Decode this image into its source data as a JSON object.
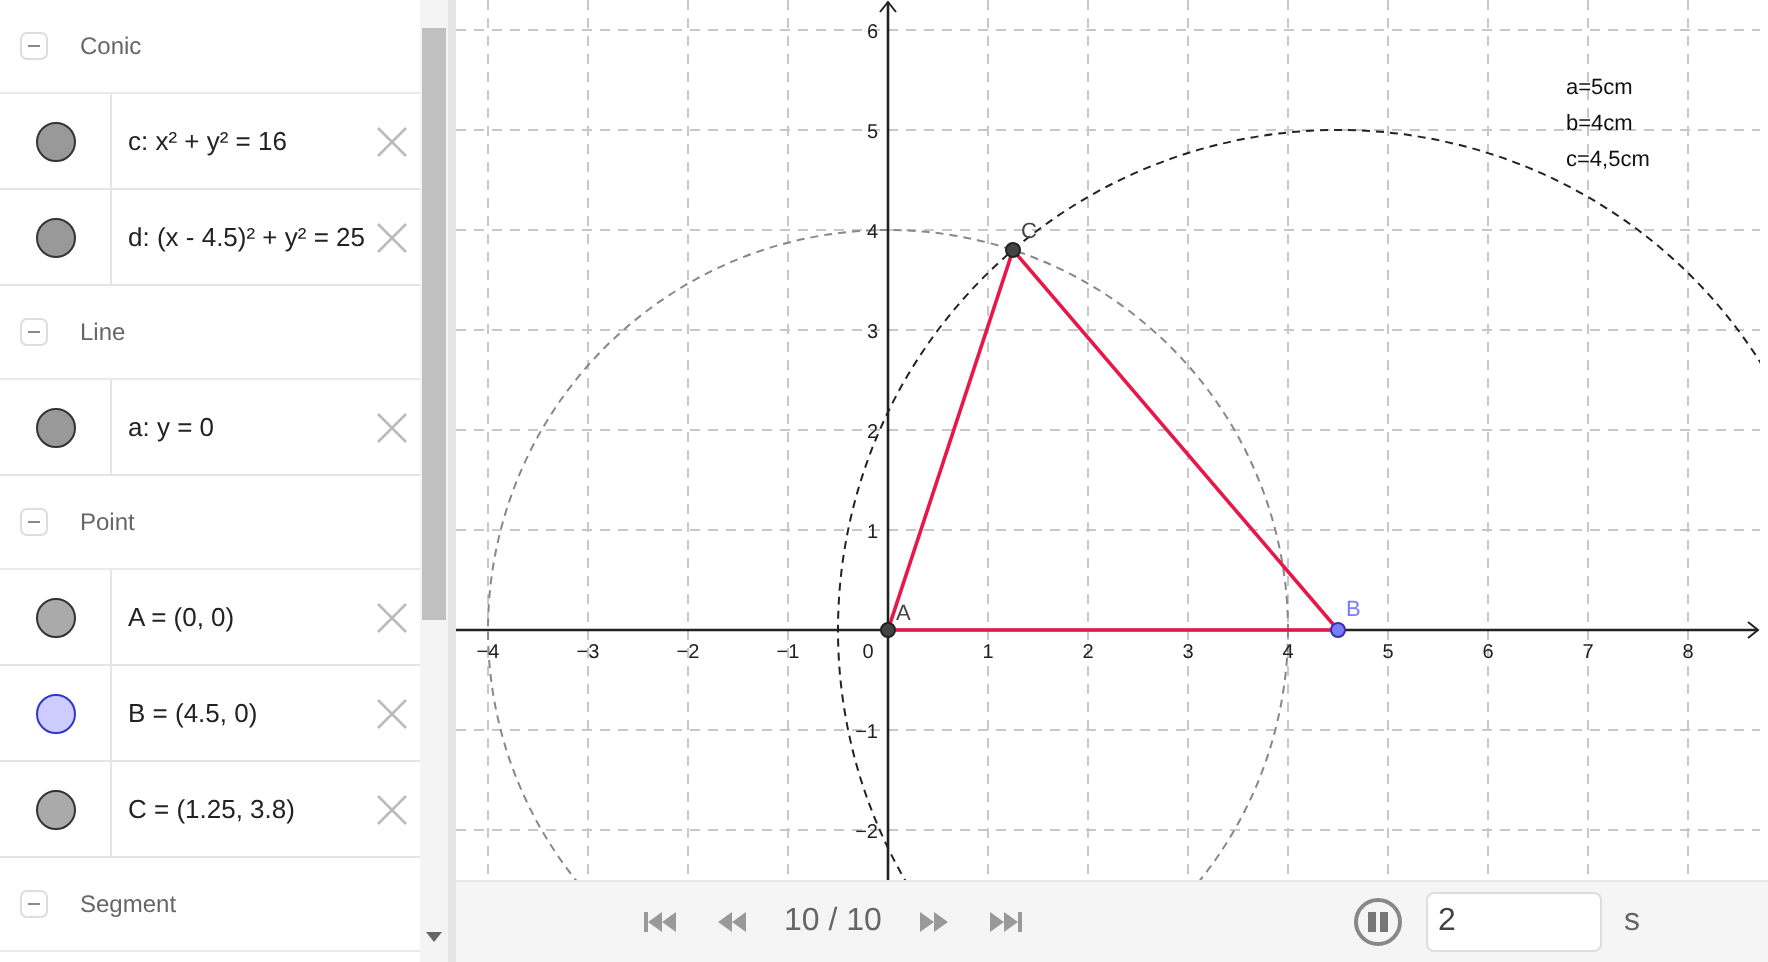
{
  "algebra_view": {
    "groups": [
      {
        "title": "Conic",
        "expanded": true,
        "items": [
          {
            "definition": "c: x² + y² = 16",
            "color": "#999999"
          },
          {
            "definition": "d: (x - 4.5)² + y² = 25",
            "color": "#999999"
          }
        ]
      },
      {
        "title": "Line",
        "expanded": true,
        "items": [
          {
            "definition": "a: y = 0",
            "color": "#999999"
          }
        ]
      },
      {
        "title": "Point",
        "expanded": true,
        "items": [
          {
            "definition": "A = (0, 0)",
            "color": "#aaaaaa"
          },
          {
            "definition": "B = (4.5, 0)",
            "color": "#ccccff"
          },
          {
            "definition": "C = (1.25, 3.8)",
            "color": "#aaaaaa"
          }
        ]
      },
      {
        "title": "Segment",
        "expanded": true
      }
    ]
  },
  "graphics": {
    "x_ticks": [
      "−4",
      "−3",
      "−2",
      "−1",
      "0",
      "1",
      "2",
      "3",
      "4",
      "5",
      "6",
      "7",
      "8"
    ],
    "y_ticks": [
      "6",
      "5",
      "4",
      "3",
      "2",
      "1",
      "−1",
      "−2"
    ],
    "points": [
      {
        "label": "A",
        "color": "#444444"
      },
      {
        "label": "B",
        "color": "#7b7bff"
      },
      {
        "label": "C",
        "color": "#444444"
      }
    ],
    "note_lines": [
      "a=5cm",
      "b=4cm",
      "c=4,5cm"
    ]
  },
  "playbar": {
    "position": "10 / 10",
    "playing": true,
    "speed": "2",
    "unit": "s"
  }
}
